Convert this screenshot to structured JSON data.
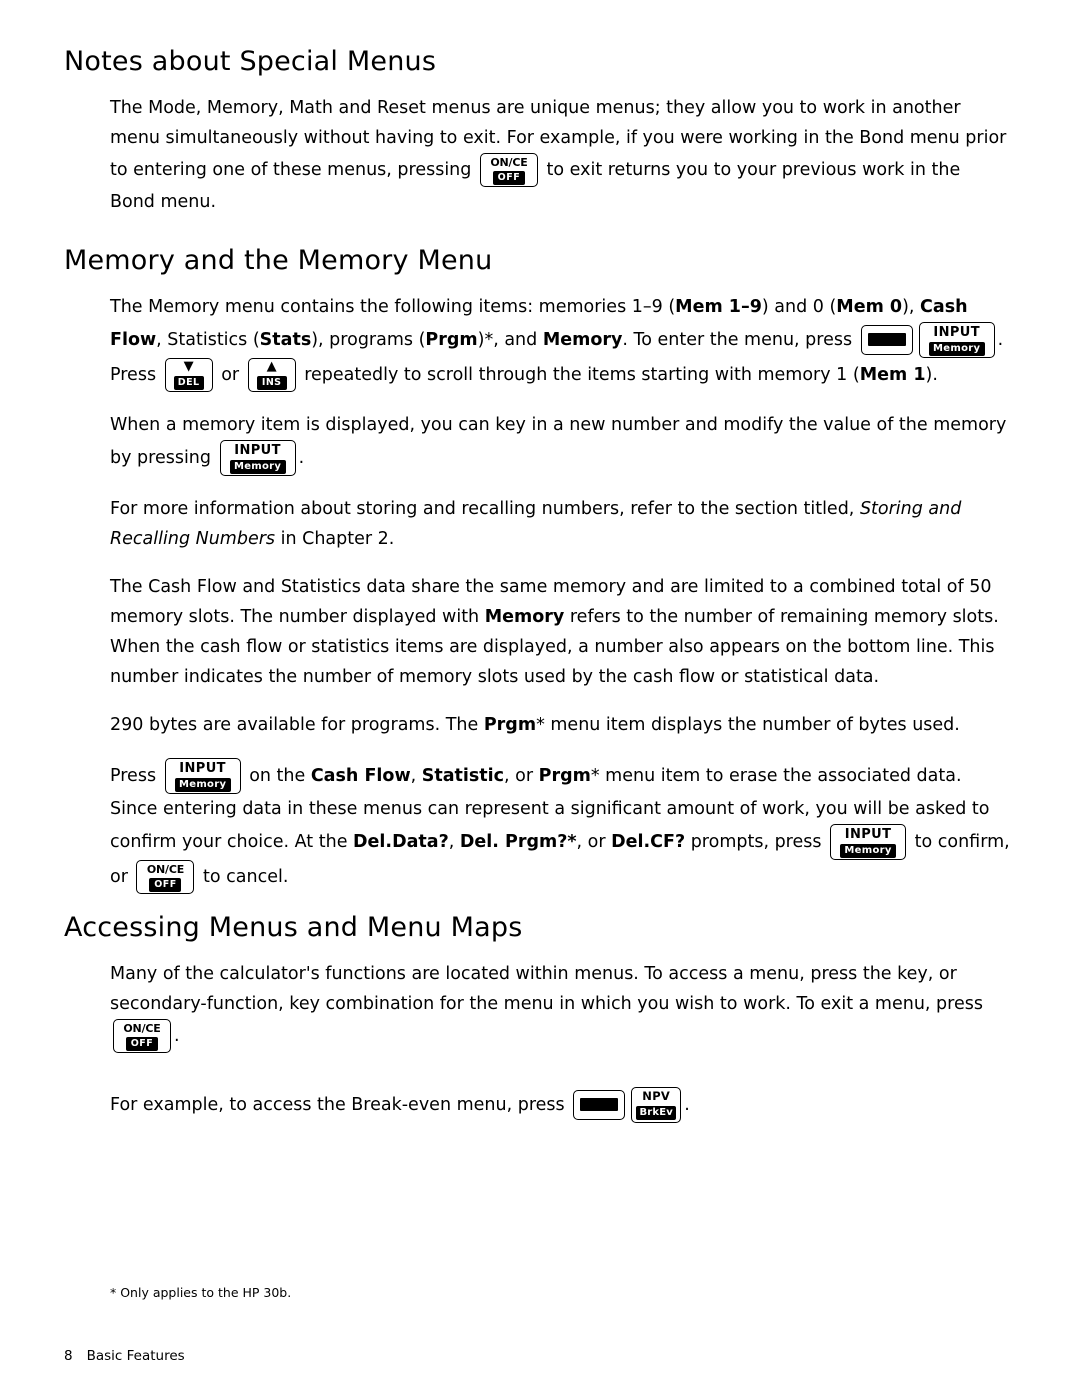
{
  "page": {
    "folio_number": "8",
    "folio_label": "Basic Features",
    "footnote": "* Only applies to the HP 30b."
  },
  "sections": [
    {
      "id": "notes-about-special-menus",
      "title": "Notes about Special Menus",
      "paragraphs": [
        {
          "id": "special-menus-p1",
          "runs": [
            {
              "t": "The Mode, Memory, Math and Reset menus are unique menus; they allow you to work in another menu simultaneously without having to exit. For example, if you were working in the Bond menu prior to entering one of these menus, pressing "
            },
            {
              "key": "onoff"
            },
            {
              "t": " to exit returns you to your previous work in the Bond menu."
            }
          ]
        }
      ]
    },
    {
      "id": "memory-and-the-memory-menu",
      "title": "Memory and the Memory Menu",
      "paragraphs": [
        {
          "id": "memory-p1",
          "runs": [
            {
              "t": "The Memory menu contains the following items: memories 1"
            },
            {
              "t": "–9 ("
            },
            {
              "t": "Mem 1–9",
              "b": true
            },
            {
              "t": ") and 0 ("
            },
            {
              "t": "Mem 0",
              "b": true
            },
            {
              "t": "), "
            },
            {
              "t": "Cash Flow",
              "b": true
            },
            {
              "t": ", Statistics ("
            },
            {
              "t": "Stats",
              "b": true
            },
            {
              "t": "), programs ("
            },
            {
              "t": "Prgm",
              "b": true
            },
            {
              "t": ")*, and "
            },
            {
              "t": "Memory",
              "b": true
            },
            {
              "t": ". To enter the menu, press "
            },
            {
              "key": "shift"
            },
            {
              "key": "input"
            },
            {
              "t": ". Press "
            },
            {
              "key": "del"
            },
            {
              "t": " or "
            },
            {
              "key": "ins"
            },
            {
              "t": " repeatedly to scroll through the items starting with memory 1 ("
            },
            {
              "t": "Mem 1",
              "b": true
            },
            {
              "t": ")."
            }
          ]
        },
        {
          "id": "memory-p2",
          "runs": [
            {
              "t": "When a memory item is displayed, you can key in a new number and modify the value of the memory by pressing "
            },
            {
              "key": "input"
            },
            {
              "t": "."
            }
          ]
        },
        {
          "id": "memory-p3",
          "runs": [
            {
              "t": "For more information about storing and recalling numbers, refer to the section titled, "
            },
            {
              "t": "Storing and Recalling Numbers",
              "i": true
            },
            {
              "t": " in Chapter 2."
            }
          ]
        },
        {
          "id": "memory-p4",
          "runs": [
            {
              "t": "The Cash Flow and Statistics data share the same memory and are limited to a combined total of 50 memory slots. The number displayed with "
            },
            {
              "t": "Memory",
              "b": true
            },
            {
              "t": " refers to the number of remaining memory slots. When the cash flow or statistics items are displayed, a number also appears on the bottom line. This number indicates the number of memory slots used by the cash flow or statistical data."
            }
          ]
        },
        {
          "id": "memory-p5",
          "runs": [
            {
              "t": "290 bytes are available for programs. The "
            },
            {
              "t": "Prgm",
              "b": true
            },
            {
              "t": "* menu item displays the number of bytes used."
            }
          ]
        },
        {
          "id": "memory-p6",
          "runs": [
            {
              "t": "Press "
            },
            {
              "key": "input"
            },
            {
              "t": " on the "
            },
            {
              "t": "Cash Flow",
              "b": true
            },
            {
              "t": ", "
            },
            {
              "t": "Statistic",
              "b": true
            },
            {
              "t": ", or "
            },
            {
              "t": "Prgm",
              "b": true
            },
            {
              "t": "* menu item to erase the associated data. Since entering data in these menus can represent a significant amount of work, you will be asked to confirm your choice. At the "
            },
            {
              "t": "Del.Data?",
              "b": true
            },
            {
              "t": ", "
            },
            {
              "t": "Del. Prgm?*",
              "b": true
            },
            {
              "t": ", or "
            },
            {
              "t": "Del.CF?",
              "b": true
            },
            {
              "t": " prompts, press "
            },
            {
              "key": "input"
            },
            {
              "t": " to confirm, or "
            },
            {
              "key": "onoff"
            },
            {
              "t": " to cancel."
            }
          ]
        }
      ]
    },
    {
      "id": "accessing-menus-and-menu-maps",
      "title": "Accessing Menus and Menu Maps",
      "paragraphs": [
        {
          "id": "accessing-p1",
          "runs": [
            {
              "t": "Many of the calculator's functions are located within menus. To access a menu, press the key, or secondary-function, key combination for the menu in which you wish to work. To exit a menu, press "
            },
            {
              "key": "onoff"
            },
            {
              "t": "."
            }
          ]
        },
        {
          "id": "accessing-p2",
          "runs": [
            {
              "t": "For example, to access the Break-even menu, press "
            },
            {
              "key": "shift"
            },
            {
              "key": "npv"
            },
            {
              "t": "."
            }
          ]
        }
      ]
    }
  ],
  "keys": {
    "onoff": {
      "top": "ON/CE",
      "bottom": "OFF",
      "name": "on-ce-off-key"
    },
    "input": {
      "top": "INPUT",
      "bottom": "Memory",
      "name": "input-memory-key"
    },
    "shift": {
      "top": "",
      "bottom": "",
      "name": "shift-key"
    },
    "del": {
      "glyph": "▼",
      "bottom": "DEL",
      "name": "down-arrow-del-key"
    },
    "ins": {
      "glyph": "▲",
      "bottom": "INS",
      "name": "up-arrow-ins-key"
    },
    "npv": {
      "top": "NPV",
      "bottom": "BrkEv",
      "name": "npv-brkev-key"
    }
  }
}
